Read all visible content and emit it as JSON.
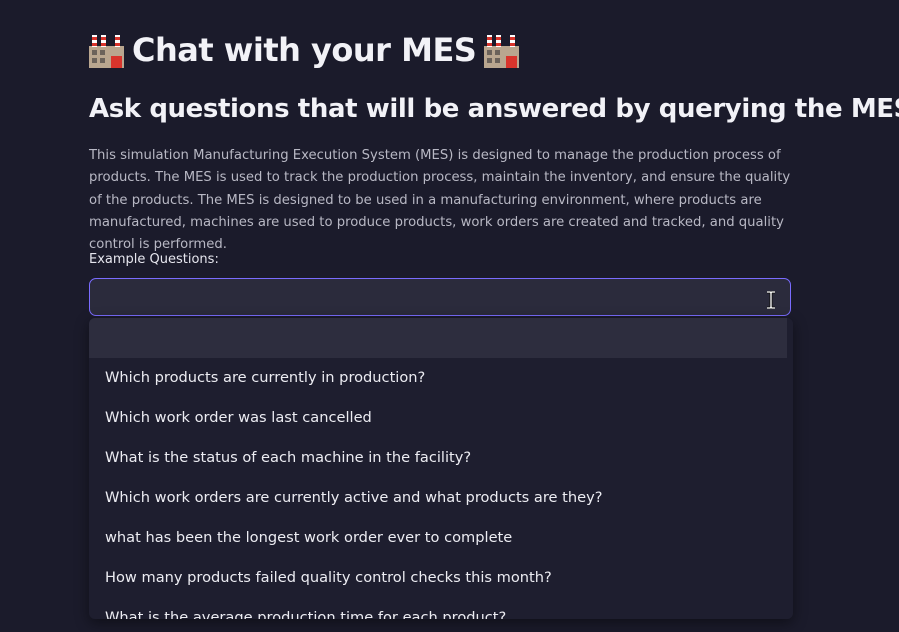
{
  "header": {
    "title": "Chat with your MES",
    "left_icon": "factory-icon",
    "right_icon": "factory-icon"
  },
  "subheader": {
    "title": "Ask questions that will be answered by querying the MES"
  },
  "description": "This simulation Manufacturing Execution System (MES) is designed to manage the production process of products. The MES is used to track the production process, maintain the inventory, and ensure the quality of the products. The MES is designed to be used in a manufacturing environment, where products are manufactured, machines are used to produce products, work orders are created and tracked, and quality control is performed.",
  "example_select": {
    "label": "Example Questions:",
    "value": "",
    "cursor_icon": "text-cursor-icon",
    "options": [
      "",
      "Which products are currently in production?",
      "Which work order was last cancelled",
      "What is the status of each machine in the facility?",
      "Which work orders are currently active and what products are they?",
      "what has been the longest work order ever to complete",
      "How many products failed quality control checks this month?",
      "What is the average production time for each product?"
    ]
  },
  "colors": {
    "background": "#1b1b2b",
    "select_border_focus": "#7a6cff",
    "select_background": "#2b2b3c",
    "highlighted_option": "#2d2d3e"
  }
}
